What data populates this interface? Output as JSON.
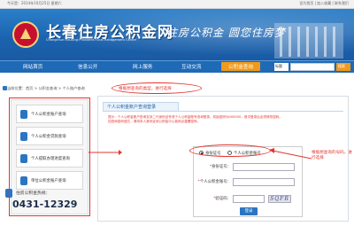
{
  "topbar": {
    "date": "今天是：2014年10月25日 星期六",
    "links": "设为首页 | 加入收藏 | 联系我们"
  },
  "header": {
    "title": "长春住房公积金网",
    "subtitle": "Changchun Housing Provident Fund Management Center",
    "slogan": "住房公积金  圆您住房梦"
  },
  "nav": {
    "items": [
      {
        "label": "网站首页",
        "active": false
      },
      {
        "label": "信息公开",
        "active": false
      },
      {
        "label": "网上服务",
        "active": false
      },
      {
        "label": "互动交流",
        "active": false
      },
      {
        "label": "公积金查询",
        "active": true
      }
    ],
    "search_scope": "标题",
    "search_button": "搜索"
  },
  "breadcrumb": "当前位置：首页 > 公积金查询 > 个人账户查询",
  "annotations": {
    "top": "根据想查询的类型，进行选择",
    "right": "根据想查询的号码，进行选择"
  },
  "sidebar": {
    "items": [
      {
        "label": "个人公积金账户查询"
      },
      {
        "label": "个人公积金贷款查询"
      },
      {
        "label": "个人提取办理进度查询"
      },
      {
        "label": "单位公积金账户查询"
      }
    ],
    "hotline_label": "住房公积金热线：",
    "hotline_phone": "0431-12329"
  },
  "main": {
    "tab_label": "个人公积金账户查询登录",
    "notice_line1": "提示：个人公积金账户查询支持二代身份证号或个人公积金账号查询登录，初始密码为000000，首次登录后必须修改密码。",
    "notice_line2": "如查询密码遗忘，请持本人身份证到公积金中心各网点重置密码。",
    "form": {
      "radio_id": "身份证号",
      "radio_account": "个人公积金账号",
      "id_label": "身份证号：",
      "name_label": "个人公积金账号：",
      "captcha_label": "验证码：",
      "captcha_text": "SQFR",
      "submit": "登录"
    }
  }
}
